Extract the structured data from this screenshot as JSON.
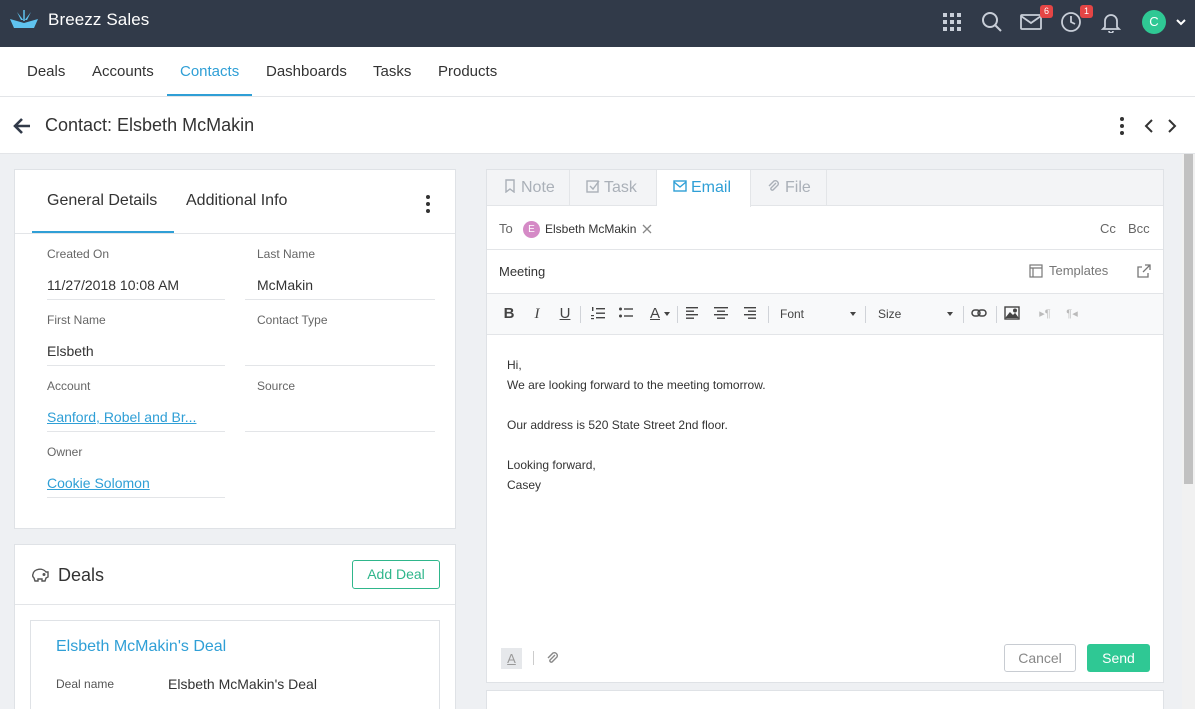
{
  "app": {
    "name": "Breezz Sales"
  },
  "topbar": {
    "mail_badge": "6",
    "reminder_badge": "1",
    "avatar_letter": "C",
    "icons": [
      "apps-grid-icon",
      "search-icon",
      "mail-icon",
      "clock-icon",
      "bell-icon"
    ]
  },
  "nav": {
    "items": [
      {
        "label": "Deals"
      },
      {
        "label": "Accounts"
      },
      {
        "label": "Contacts",
        "active": true
      },
      {
        "label": "Dashboards"
      },
      {
        "label": "Tasks"
      },
      {
        "label": "Products"
      }
    ]
  },
  "page": {
    "title": "Contact: Elsbeth McMakin"
  },
  "details": {
    "tabs": [
      "General Details",
      "Additional Info"
    ],
    "fields": {
      "created_on": {
        "label": "Created On",
        "value": "11/27/2018 10:08 AM"
      },
      "last_name": {
        "label": "Last Name",
        "value": "McMakin"
      },
      "first_name": {
        "label": "First Name",
        "value": "Elsbeth"
      },
      "contact_type": {
        "label": "Contact Type",
        "value": ""
      },
      "account": {
        "label": "Account",
        "value": "Sanford, Robel and Br..."
      },
      "source": {
        "label": "Source",
        "value": ""
      },
      "owner": {
        "label": "Owner",
        "value": "Cookie Solomon"
      }
    }
  },
  "deals": {
    "title": "Deals",
    "add_label": "Add Deal",
    "items": [
      {
        "title": "Elsbeth McMakin's Deal",
        "name_label": "Deal name",
        "name_value": "Elsbeth McMakin's Deal"
      }
    ]
  },
  "composer": {
    "tabs": [
      "Note",
      "Task",
      "Email",
      "File"
    ],
    "active_tab": "Email",
    "to_label": "To",
    "recipient": {
      "initial": "E",
      "name": "Elsbeth McMakin"
    },
    "cc_label": "Cc",
    "bcc_label": "Bcc",
    "subject": "Meeting",
    "templates_label": "Templates",
    "toolbar": {
      "font_label": "Font",
      "size_label": "Size"
    },
    "body_lines": [
      "Hi,",
      "We are looking forward to the meeting tomorrow.",
      "",
      "Our address is 520 State Street 2nd floor.",
      "",
      "Looking forward,",
      "Casey"
    ],
    "cancel_label": "Cancel",
    "send_label": "Send"
  }
}
